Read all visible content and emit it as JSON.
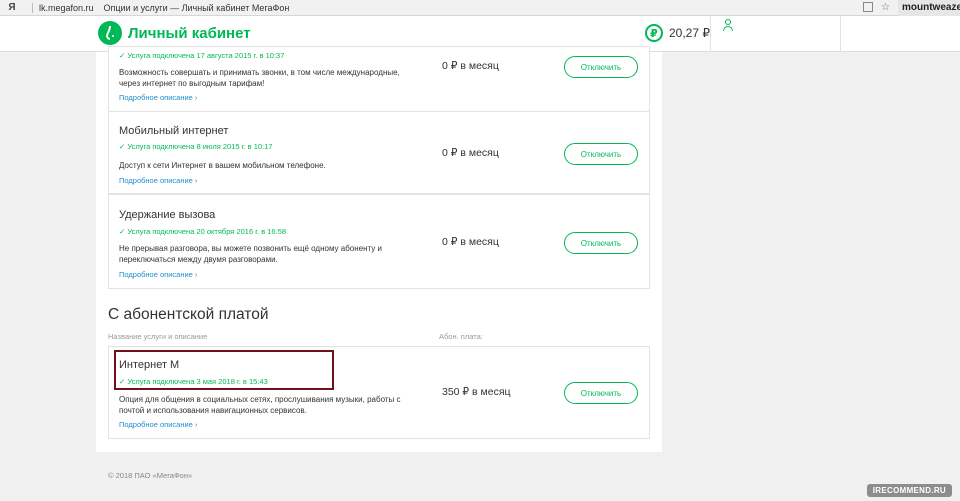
{
  "browser": {
    "ya": "Я",
    "url": "lk.megafon.ru",
    "tab_title": "Опции и услуги — Личный кабинет МегаФон",
    "star_icon": "☆",
    "user": "mountweazel"
  },
  "header": {
    "logo_icon": "megafon-logo-icon",
    "brand": "Личный кабинет",
    "balance_symbol": "₽",
    "balance": "20,27 ₽"
  },
  "services": [
    {
      "name": "",
      "connected": "✓  Услуга подключена 17 августа 2015 г. в 10:37",
      "description": "Возможность совершать и принимать звонки, в том числе международные, через интернет по выгодным тарифам!",
      "link": "Подробное описание ›",
      "price": "0 ₽ в месяц",
      "button": "Отключить"
    },
    {
      "name": "Мобильный интернет",
      "connected": "✓  Услуга подключена 8 июля 2015 г. в 10:17",
      "description": "Доступ к сети Интернет в вашем мобильном телефоне.",
      "link": "Подробное описание ›",
      "price": "0 ₽ в месяц",
      "button": "Отключить"
    },
    {
      "name": "Удержание вызова",
      "connected": "✓  Услуга подключена 20 октября 2016 г. в 16:58",
      "description": "Не прерывая разговора, вы можете позвонить ещё одному абоненту и переключаться между двумя разговорами.",
      "link": "Подробное описание ›",
      "price": "0 ₽ в месяц",
      "button": "Отключить"
    }
  ],
  "paid_section": {
    "heading": "С абонентской платой",
    "col_name": "Название услуги и описание",
    "col_price": "Абон. плата:",
    "service": {
      "name": "Интернет М",
      "connected": "✓  Услуга подключена 3 мая 2018 г. в 15:43",
      "description": "Опция для общения в социальных сетях, прослушивания музыки, работы с почтой и использования навигационных сервисов.",
      "link": "Подробное описание ›",
      "price": "350 ₽ в месяц",
      "button": "Отключить"
    }
  },
  "footer": "© 2018 ПАО «МегаФон»",
  "watermark": "IRECOMMEND.RU",
  "colors": {
    "brand": "#00b956",
    "link": "#1f8ecf",
    "highlight": "#6e1020"
  }
}
